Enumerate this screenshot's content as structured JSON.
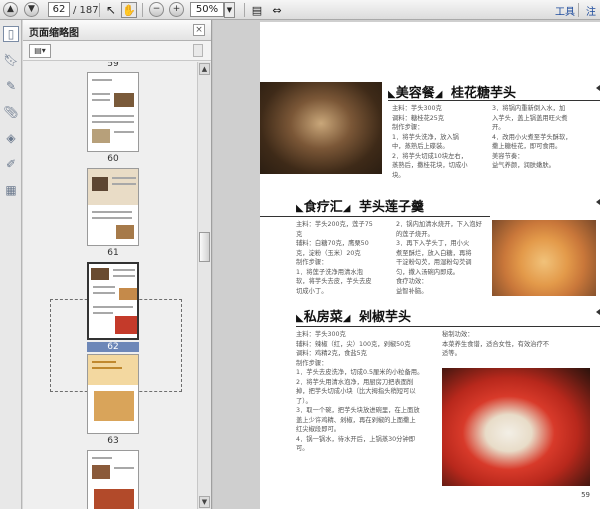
{
  "toolbar": {
    "page_current": "62",
    "page_total": "/ 187",
    "zoom": "50%",
    "tools_menu": "工具",
    "annotate_menu": "注"
  },
  "panel": {
    "title": "页面缩略图",
    "thumbs": [
      {
        "label": "59"
      },
      {
        "label": "60"
      },
      {
        "label": "61"
      },
      {
        "label": "62",
        "selected": true
      },
      {
        "label": "63"
      },
      {
        "label": ""
      }
    ]
  },
  "page": {
    "number": "59",
    "sections": [
      {
        "title": "美容餐",
        "subtitle": "桂花糖芋头",
        "lines_left": [
          "主料：芋头300克",
          "调料：糖桂花25克",
          "制作步骤：",
          "1．将芋头洗净，放入锅",
          "中，蒸熟后上碟装。",
          "2．将芋头切成10块左右，",
          "蒸熟后，撒桂花块，切成小",
          "块。"
        ],
        "lines_right": [
          "3．将锅内重新倒入水，加",
          "入芋头，盖上锅盖用旺火煮",
          "开。",
          "4．改用小火煮至芋头酥软，",
          "撒上糖桂花，即可食用。",
          "美容节奏：",
          "益气养颜，润肤嫩肤。"
        ]
      },
      {
        "title": "食疗汇",
        "subtitle": "芋头莲子羹",
        "lines_left": [
          "主料：芋头200克，莲子75",
          "克",
          "辅料：白糖70克，鹰栗50",
          "克，淀粉（玉米）20克",
          "制作步骤：",
          "1．将莲子洗净用清水泡",
          "软，将芋头去皮，芋头去皮",
          "切成小丁。"
        ],
        "lines_right": [
          "2．锅内加清水烧开，下入泡好",
          "的莲子烧开。",
          "3．再下入芋头丁，用小火",
          "煮至酥烂，放入白糖，再将",
          "干淀粉勾芡，用湿粉勾芡调",
          "匀，撒入汤碗内即成。",
          "食疗功效：",
          "益智补脑。"
        ]
      },
      {
        "title": "私房菜",
        "subtitle": "剁椒芋头",
        "lines_left": [
          "主料：芋头300克",
          "辅料：辣椒（红，尖）100克，剁椒50克",
          "调料：鸡精2克，食盐5克",
          "制作步骤：",
          "1．芋头去皮洗净，切成0.5厘米的小粒备用。",
          "2．将芋头用清水泡净，用厨房刀把表面削",
          "掉，把芋头切成小块（比大拇指头稍短可以",
          "了）。",
          "3．取一个碗，把芋头块放进碗里，在上面放",
          "盖上少许鸡精、剁椒，再在剁椒的上面撒上",
          "红尖椒段即可。",
          "4．锅一锅水，待水开后，上锅蒸30分钟即",
          "可。"
        ],
        "lines_right": [
          "秘制功效：",
          "本菜养生食谱，适合女性，有效治疗不",
          "适等。"
        ]
      }
    ]
  },
  "colors": {
    "accent_brown": "#9a5a12",
    "selection_blue": "#6d87b8",
    "photo_red": "#d63a2a"
  }
}
